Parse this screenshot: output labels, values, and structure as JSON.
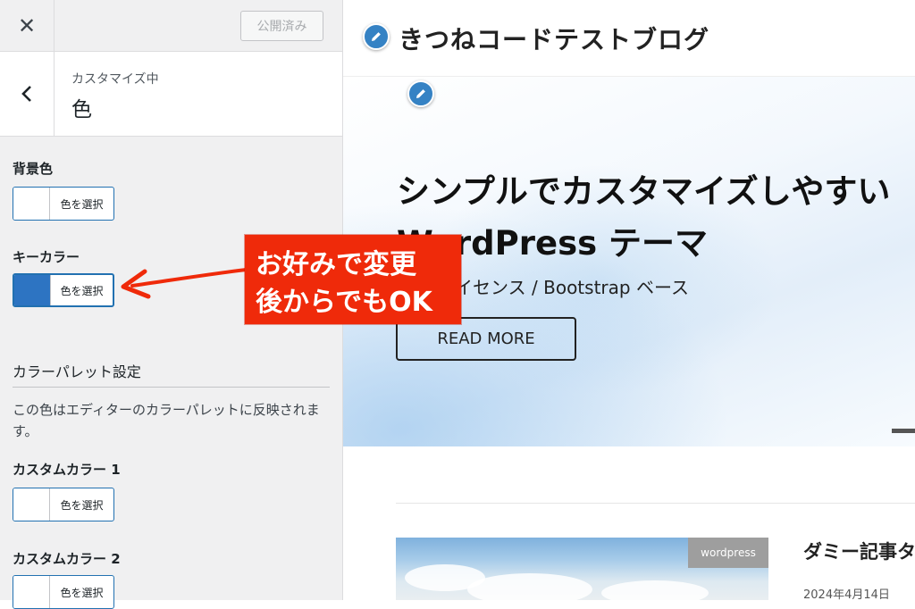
{
  "panel": {
    "close_icon": "close-icon",
    "publish_label": "公開済み",
    "back_icon": "chevron-left-icon",
    "section_sub": "カスタマイズ中",
    "section_title": "色",
    "controls": [
      {
        "label": "背景色",
        "button": "色を選択",
        "swatch": "#ffffff"
      },
      {
        "label": "キーカラー",
        "button": "色を選択",
        "swatch": "#2d74c2"
      }
    ],
    "palette_title": "カラーパレット設定",
    "palette_desc": "この色はエディターのカラーパレットに反映されます。",
    "custom_colors": [
      {
        "label": "カスタムカラー 1",
        "button": "色を選択"
      },
      {
        "label": "カスタムカラー 2",
        "button": "色を選択"
      }
    ]
  },
  "preview": {
    "site_title": "きつねコードテストブログ",
    "hero_line1": "シンプルでカスタマイズしやすい",
    "hero_line2": "WordPress テーマ",
    "hero_sub": "GPL ライセンス / Bootstrap ベース",
    "read_more": "READ MORE",
    "post_tag": "wordpress",
    "post_title": "ダミー記事タ",
    "post_date": "2024年4月14日"
  },
  "annotation": {
    "line1": "お好みで変更",
    "line2": "後からでもOK",
    "color": "#ef2a0a"
  },
  "colors": {
    "accent": "#2271b1",
    "key_color": "#2d74c2",
    "edit_shortcut": "#3582c4"
  }
}
